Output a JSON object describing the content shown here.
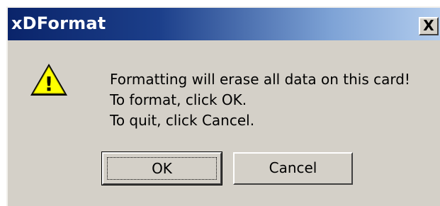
{
  "window": {
    "title": "xDFormat",
    "close_label": "X"
  },
  "icon": {
    "name": "warning-icon",
    "glyph": "!",
    "fill_color": "#ffff00"
  },
  "message": {
    "lines": [
      "Formatting will erase all data on this card!",
      "To format, click OK.",
      "To quit, click Cancel."
    ]
  },
  "buttons": {
    "ok_label": "OK",
    "cancel_label": "Cancel"
  },
  "colors": {
    "titlebar_start": "#0a246a",
    "titlebar_end": "#b3cdee",
    "dialog_face": "#d4d0c8"
  }
}
